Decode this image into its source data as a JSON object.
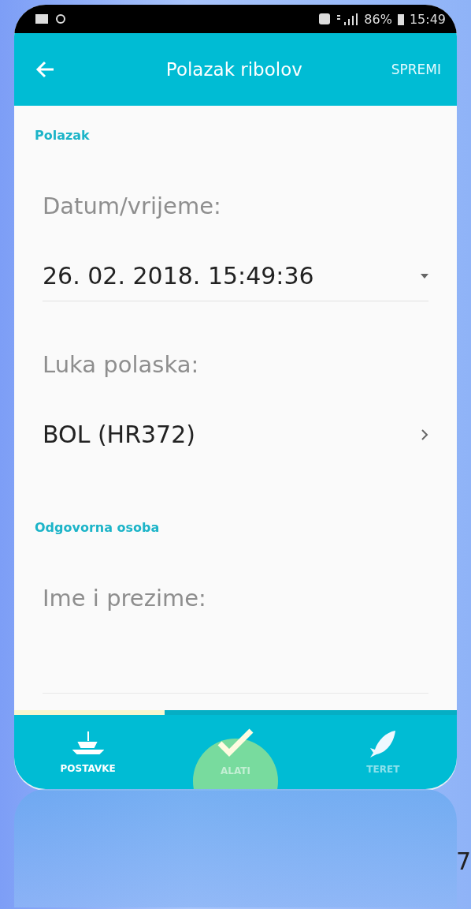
{
  "status_bar": {
    "battery": "86%",
    "time": "15:49"
  },
  "app_bar": {
    "title": "Polazak ribolov",
    "action": "SPREMI"
  },
  "sections": [
    {
      "title": "Polazak",
      "fields": [
        {
          "kind": "dropdown",
          "label": "Datum/vrijeme:",
          "value": "26. 02. 2018. 15:49:36"
        },
        {
          "kind": "link",
          "label": "Luka polaska:",
          "value": "BOL (HR372)"
        }
      ]
    },
    {
      "title": "Odgovorna osoba",
      "fields": [
        {
          "kind": "input",
          "label": "Ime i prezime:"
        }
      ]
    }
  ],
  "progress": {
    "level": 0.34
  },
  "bottom_nav": [
    {
      "label": "POSTAVKE",
      "kind": "boat",
      "selected": true,
      "pressed": false
    },
    {
      "label": "ALATI",
      "kind": "check",
      "selected": false,
      "pressed": true
    },
    {
      "label": "TERET",
      "kind": "fish",
      "selected": false,
      "pressed": false
    }
  ],
  "slide_number": "7"
}
